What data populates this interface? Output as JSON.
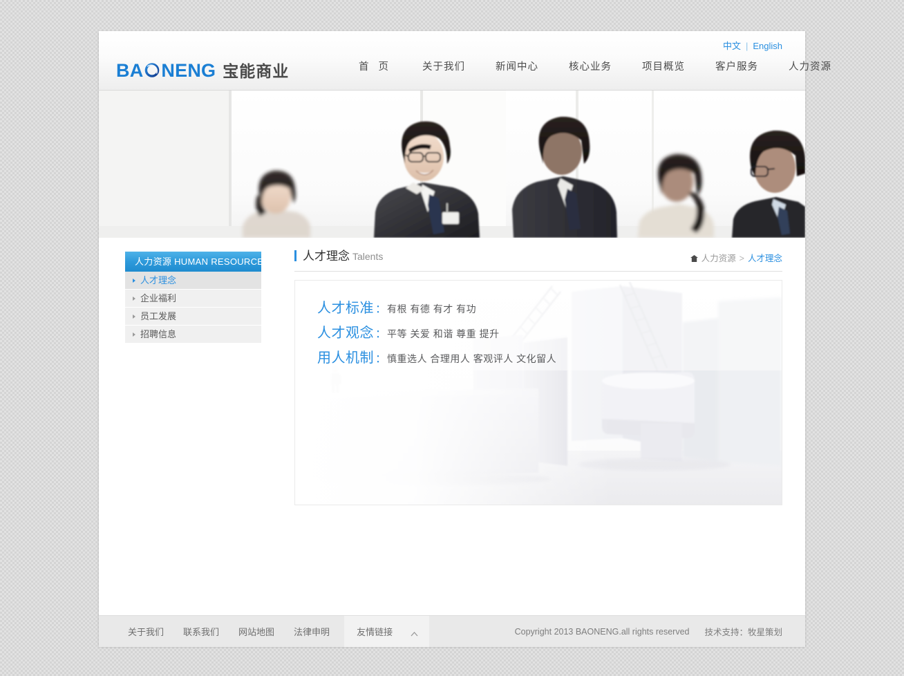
{
  "header": {
    "logo_latin": "BAONENG",
    "logo_latin_pre": "BA",
    "logo_latin_post": "NENG",
    "logo_cn": "宝能商业",
    "lang": {
      "chinese": "中文",
      "separator": "|",
      "english": "English"
    },
    "nav": [
      {
        "label": "首 页"
      },
      {
        "label": "关于我们"
      },
      {
        "label": "新闻中心"
      },
      {
        "label": "核心业务"
      },
      {
        "label": "项目概览"
      },
      {
        "label": "客户服务"
      },
      {
        "label": "人力资源"
      }
    ]
  },
  "sidebar": {
    "title": "人力资源 HUMAN RESOURCES",
    "items": [
      {
        "label": "人才理念",
        "active": true
      },
      {
        "label": "企业福利",
        "active": false
      },
      {
        "label": "员工发展",
        "active": false
      },
      {
        "label": "招聘信息",
        "active": false
      }
    ]
  },
  "content": {
    "title_cn": "人才理念",
    "title_en": "Talents",
    "breadcrumb": {
      "parent": "人力资源",
      "separator": ">",
      "current": "人才理念"
    },
    "talents": [
      {
        "label": "人才标准",
        "colon": "：",
        "value": "有根 有德 有才 有功"
      },
      {
        "label": "人才观念",
        "colon": "：",
        "value": "平等 关爱 和谐 尊重 提升"
      },
      {
        "label": "用人机制",
        "colon": "：",
        "value": "慎重选人 合理用人 客观评人 文化留人"
      }
    ]
  },
  "footer": {
    "links": [
      {
        "label": "关于我们"
      },
      {
        "label": "联系我们"
      },
      {
        "label": "网站地图"
      },
      {
        "label": "法律申明"
      }
    ],
    "friend_links": "友情链接",
    "copyright": "Copyright 2013 BAONENG.all rights reserved",
    "tech_support": "技术支持：牧星策划"
  },
  "colors": {
    "accent": "#2a8fe0",
    "sidebar_head_from": "#4eb2e8",
    "sidebar_head_to": "#1f8ccf",
    "text_dark": "#4c4c4c",
    "text_muted": "#7d7d7d"
  }
}
